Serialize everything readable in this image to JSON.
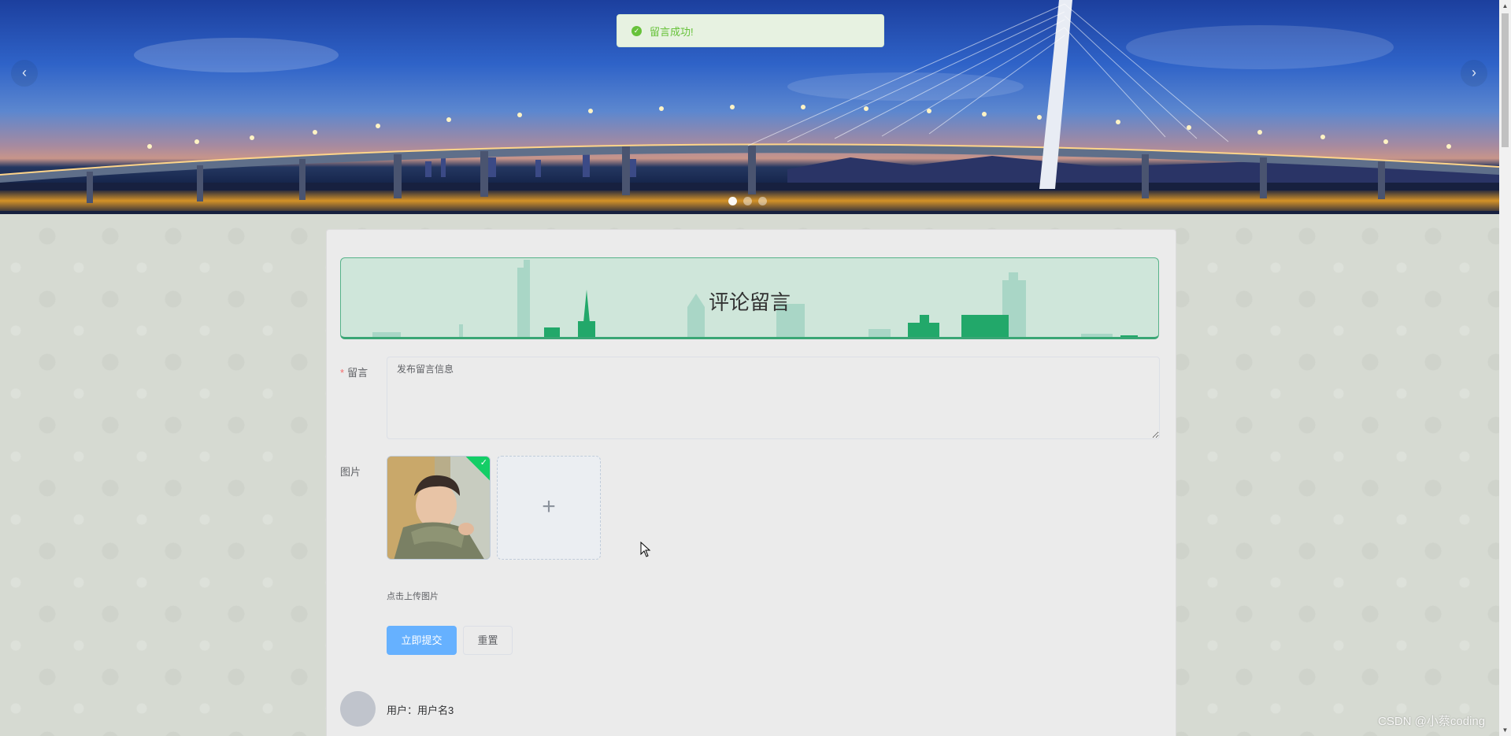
{
  "toast": {
    "icon": "check-circle-icon",
    "message": "留言成功!"
  },
  "carousel": {
    "prev_icon": "chevron-left-icon",
    "next_icon": "chevron-right-icon",
    "prev_glyph": "‹",
    "next_glyph": "›",
    "slide_count": 3,
    "active_index": 0
  },
  "section": {
    "title": "评论留言"
  },
  "form": {
    "message_label": "留言",
    "message_required_mark": "*",
    "message_value": "发布留言信息",
    "image_label": "图片",
    "upload_plus": "+",
    "upload_tip": "点击上传图片",
    "submit_label": "立即提交",
    "reset_label": "重置"
  },
  "comments": [
    {
      "user_text": "用户：用户名3"
    }
  ],
  "watermark": "CSDN @小蔡coding",
  "colors": {
    "primary": "#66b1ff",
    "success": "#67c23a",
    "header_green": "#3aa675"
  }
}
